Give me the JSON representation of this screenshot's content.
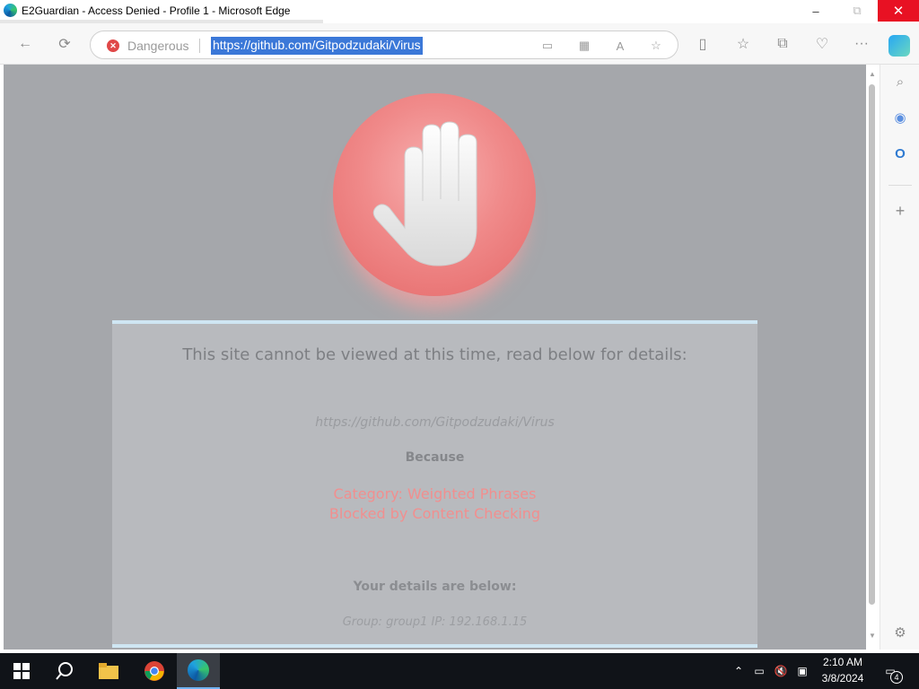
{
  "window": {
    "title": "E2Guardian - Access Denied - Profile 1 - Microsoft Edge",
    "minimize": "–",
    "maximize": "⧉",
    "close": "✕"
  },
  "toolbar": {
    "security_label": "Dangerous",
    "url": "https://github.com/Gitpodzudaki/Virus",
    "back_icon": "←",
    "refresh_icon": "⟳",
    "more_icon": "···"
  },
  "page": {
    "heading": "This site cannot be viewed at this time, read below for details:",
    "blocked_url": "https://github.com/Gitpodzudaki/Virus",
    "because": "Because",
    "reason_1": "Category: Weighted Phrases",
    "reason_2": "Blocked by Content Checking",
    "details_heading": "Your details are below:",
    "details_line": "Group: group1   IP: 192.168.1.15"
  },
  "colors": {
    "page_overlay": "#a5a7ab",
    "reason_text": "#f18f8f",
    "stop_sign": "#e56868",
    "close_button": "#e81123"
  },
  "taskbar": {
    "time": "2:10 AM",
    "date": "3/8/2024",
    "notification_count": "4"
  }
}
